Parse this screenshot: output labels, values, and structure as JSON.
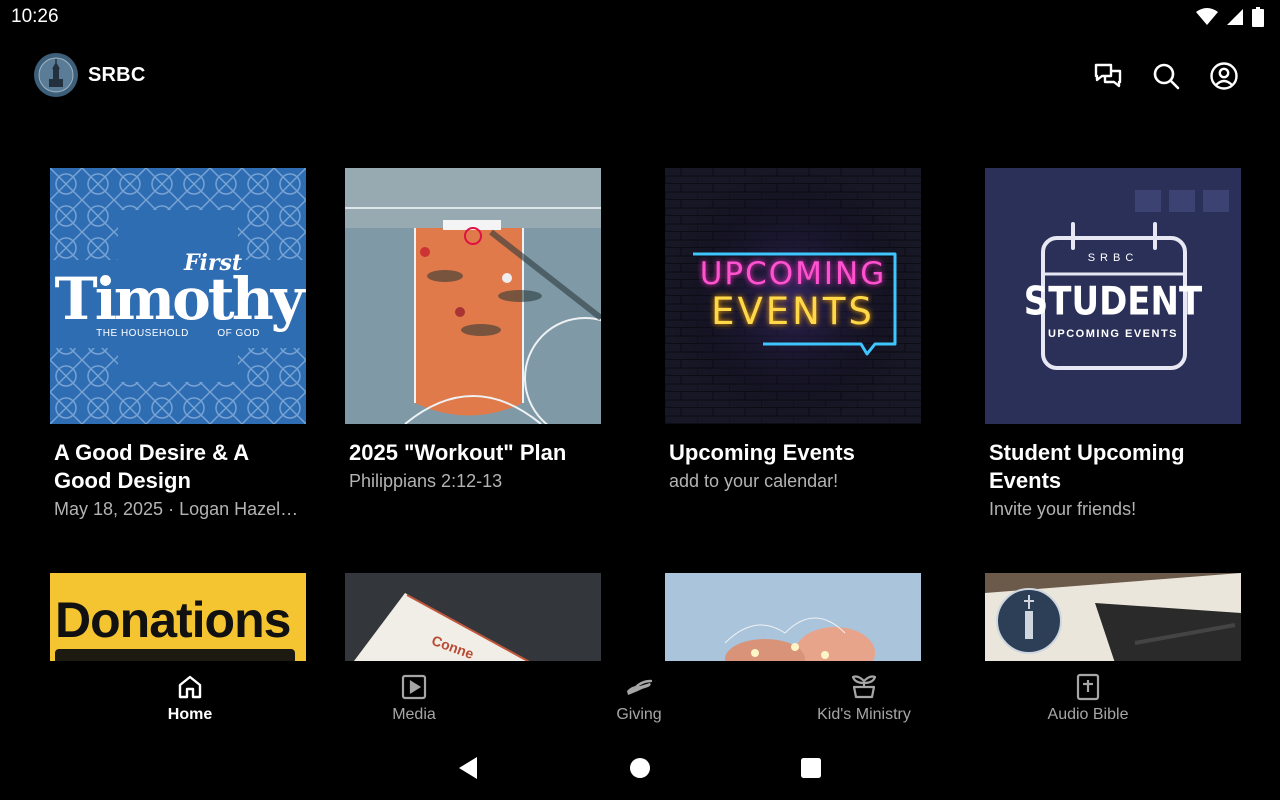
{
  "status_bar": {
    "time": "10:26"
  },
  "app_bar": {
    "title": "SRBC"
  },
  "cards": [
    {
      "title": "A Good Desire & A Good Design",
      "subtitle": "May 18, 2025 · Logan Hazel…",
      "art": {
        "small": "First",
        "big": "Timothy",
        "caption_left": "THE HOUSEHOLD",
        "caption_right": "OF GOD"
      }
    },
    {
      "title": "2025 \"Workout\" Plan",
      "subtitle": "Philippians 2:12-13"
    },
    {
      "title": "Upcoming Events",
      "subtitle": "add to your calendar!",
      "art": {
        "line1": "UPCOMING",
        "line2": "EVENTS"
      }
    },
    {
      "title": "Student Upcoming Events",
      "subtitle": "Invite your friends!",
      "art": {
        "org": "SRBC",
        "big": "STUDENT",
        "small": "UPCOMING EVENTS"
      }
    },
    {
      "art": {
        "text": "Donations"
      }
    },
    {
      "art": {
        "text": "Conne"
      }
    },
    {},
    {}
  ],
  "bottom_nav": [
    {
      "label": "Home",
      "icon": "home-icon",
      "active": true
    },
    {
      "label": "Media",
      "icon": "play-box-icon"
    },
    {
      "label": "Giving",
      "icon": "giving-hand-icon"
    },
    {
      "label": "Kid's Ministry",
      "icon": "sprout-icon"
    },
    {
      "label": "Audio Bible",
      "icon": "bible-icon"
    }
  ],
  "colors": {
    "background": "#000000",
    "text_primary": "#ffffff",
    "text_secondary": "#b3b3b3",
    "nav_inactive": "#a6a6a6",
    "donations_yellow": "#f4c531",
    "timothy_blue": "#2e6db4",
    "neon_pink": "#ff3ec8",
    "neon_yellow": "#ffd84a",
    "neon_blue": "#3ec6ff"
  }
}
